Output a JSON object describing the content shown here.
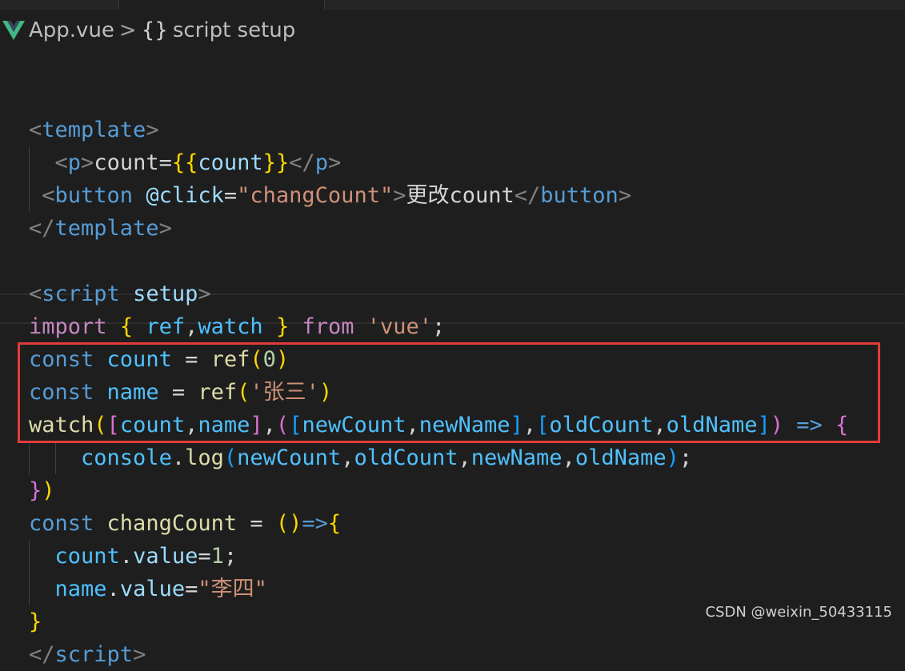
{
  "breadcrumb": {
    "file": "App.vue",
    "separator": ">",
    "braces": "{}",
    "symbol": "script setup"
  },
  "colors": {
    "background": "#1e1e1e",
    "highlight_box": "#e33b3b",
    "vue_icon": "#42b883"
  },
  "icons": {
    "file_icon": "vue-logo-icon"
  },
  "code_lines": [
    [
      [
        "punc",
        "<"
      ],
      [
        "tag",
        "template"
      ],
      [
        "punc",
        ">"
      ]
    ],
    [
      [
        "punc",
        "  <"
      ],
      [
        "tag",
        "p"
      ],
      [
        "punc",
        ">"
      ],
      [
        "text",
        "count="
      ],
      [
        "b1",
        "{{"
      ],
      [
        "attr",
        "count"
      ],
      [
        "b1",
        "}}"
      ],
      [
        "punc",
        "</"
      ],
      [
        "tag",
        "p"
      ],
      [
        "punc",
        ">"
      ]
    ],
    [
      [
        "punc",
        " <"
      ],
      [
        "tag",
        "button"
      ],
      [
        "text",
        " "
      ],
      [
        "attr",
        "@click"
      ],
      [
        "text",
        "="
      ],
      [
        "str",
        "\"changCount\""
      ],
      [
        "punc",
        ">"
      ],
      [
        "text",
        "更改count"
      ],
      [
        "punc",
        "</"
      ],
      [
        "tag",
        "button"
      ],
      [
        "punc",
        ">"
      ]
    ],
    [
      [
        "punc",
        "</"
      ],
      [
        "tag",
        "template"
      ],
      [
        "punc",
        ">"
      ]
    ],
    [],
    [
      [
        "punc",
        "<"
      ],
      [
        "tag",
        "script"
      ],
      [
        "text",
        " "
      ],
      [
        "attr",
        "setup"
      ],
      [
        "punc",
        ">"
      ]
    ],
    [
      [
        "kw",
        "import"
      ],
      [
        "text",
        " "
      ],
      [
        "b1",
        "{"
      ],
      [
        "text",
        " "
      ],
      [
        "var",
        "ref"
      ],
      [
        "text",
        ","
      ],
      [
        "var",
        "watch"
      ],
      [
        "text",
        " "
      ],
      [
        "b1",
        "}"
      ],
      [
        "text",
        " "
      ],
      [
        "kw",
        "from"
      ],
      [
        "text",
        " "
      ],
      [
        "str",
        "'vue'"
      ],
      [
        "text",
        ";"
      ]
    ],
    [
      [
        "decl",
        "const"
      ],
      [
        "text",
        " "
      ],
      [
        "var",
        "count"
      ],
      [
        "text",
        " = "
      ],
      [
        "fn",
        "ref"
      ],
      [
        "b1",
        "("
      ],
      [
        "num",
        "0"
      ],
      [
        "b1",
        ")"
      ]
    ],
    [
      [
        "decl",
        "const"
      ],
      [
        "text",
        " "
      ],
      [
        "var",
        "name"
      ],
      [
        "text",
        " = "
      ],
      [
        "fn",
        "ref"
      ],
      [
        "b1",
        "("
      ],
      [
        "str",
        "'张三'"
      ],
      [
        "b1",
        ")"
      ]
    ],
    [
      [
        "fn",
        "watch"
      ],
      [
        "b1",
        "("
      ],
      [
        "b2",
        "["
      ],
      [
        "var",
        "count"
      ],
      [
        "text",
        ","
      ],
      [
        "var",
        "name"
      ],
      [
        "b2",
        "]"
      ],
      [
        "text",
        ","
      ],
      [
        "b2",
        "("
      ],
      [
        "b3",
        "["
      ],
      [
        "var",
        "newCount"
      ],
      [
        "text",
        ","
      ],
      [
        "var",
        "newName"
      ],
      [
        "b3",
        "]"
      ],
      [
        "text",
        ","
      ],
      [
        "b3",
        "["
      ],
      [
        "var",
        "oldCount"
      ],
      [
        "text",
        ","
      ],
      [
        "var",
        "oldName"
      ],
      [
        "b3",
        "]"
      ],
      [
        "b2",
        ")"
      ],
      [
        "text",
        " "
      ],
      [
        "arrow",
        "=>"
      ],
      [
        "text",
        " "
      ],
      [
        "b2",
        "{"
      ]
    ],
    [
      [
        "text",
        "    "
      ],
      [
        "var",
        "console"
      ],
      [
        "text",
        "."
      ],
      [
        "fn",
        "log"
      ],
      [
        "b3",
        "("
      ],
      [
        "var",
        "newCount"
      ],
      [
        "text",
        ","
      ],
      [
        "var",
        "oldCount"
      ],
      [
        "text",
        ","
      ],
      [
        "var",
        "newName"
      ],
      [
        "text",
        ","
      ],
      [
        "var",
        "oldName"
      ],
      [
        "b3",
        ")"
      ],
      [
        "text",
        ";"
      ]
    ],
    [
      [
        "b2",
        "}"
      ],
      [
        "b1",
        ")"
      ]
    ],
    [
      [
        "decl",
        "const"
      ],
      [
        "text",
        " "
      ],
      [
        "fn",
        "changCount"
      ],
      [
        "text",
        " = "
      ],
      [
        "b1",
        "()"
      ],
      [
        "arrow",
        "=>"
      ],
      [
        "b1",
        "{"
      ]
    ],
    [
      [
        "text",
        "  "
      ],
      [
        "var",
        "count"
      ],
      [
        "text",
        "."
      ],
      [
        "prop",
        "value"
      ],
      [
        "text",
        "="
      ],
      [
        "num",
        "1"
      ],
      [
        "text",
        ";"
      ]
    ],
    [
      [
        "text",
        "  "
      ],
      [
        "var",
        "name"
      ],
      [
        "text",
        "."
      ],
      [
        "prop",
        "value"
      ],
      [
        "text",
        "="
      ],
      [
        "str",
        "\"李四\""
      ]
    ],
    [
      [
        "b1",
        "}"
      ]
    ],
    [
      [
        "punc",
        "</"
      ],
      [
        "tag",
        "script"
      ],
      [
        "punc",
        ">"
      ]
    ]
  ],
  "watermark": "CSDN @weixin_50433115"
}
